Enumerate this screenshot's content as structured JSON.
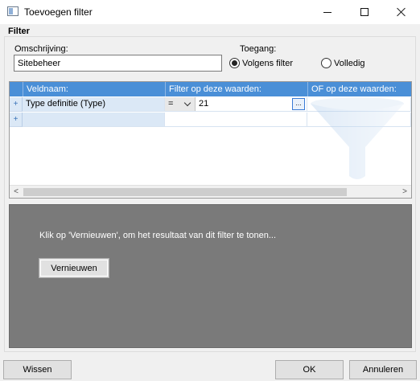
{
  "window": {
    "title": "Toevoegen filter",
    "minimize_icon": "minimize-icon",
    "maximize_icon": "maximize-icon",
    "close_icon": "close-icon"
  },
  "filter_group": {
    "label": "Filter",
    "description_label": "Omschrijving:",
    "description_value": "Sitebeheer",
    "access_label": "Toegang:",
    "access_options": [
      {
        "label": "Volgens filter",
        "checked": true
      },
      {
        "label": "Volledig",
        "checked": false
      }
    ]
  },
  "grid": {
    "columns": [
      "Veldnaam:",
      "Filter op deze waarden:",
      "OF op deze waarden:"
    ],
    "rows": [
      {
        "marker": "+",
        "field": "Type definitie (Type)",
        "operator": "=",
        "value": "21",
        "value_button": "..."
      },
      {
        "marker": "+",
        "field": "",
        "operator": "",
        "value": "",
        "value_button": ""
      }
    ],
    "scroll_left": "<",
    "scroll_right": ">"
  },
  "result_panel": {
    "message": "Klik op 'Vernieuwen', om het resultaat van dit filter te tonen...",
    "refresh_label": "Vernieuwen"
  },
  "footer": {
    "clear_label": "Wissen",
    "ok_label": "OK",
    "cancel_label": "Annuleren"
  },
  "colors": {
    "grid_header": "#4a8fd7",
    "row_highlight": "#dbe8f6",
    "result_panel": "#7a7a7a"
  }
}
